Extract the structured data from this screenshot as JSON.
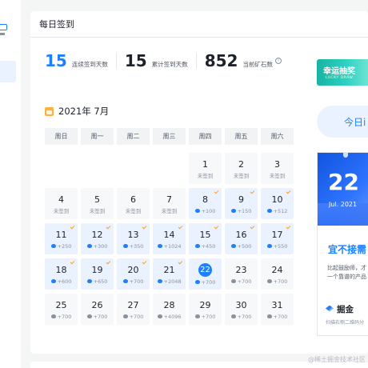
{
  "card": {
    "title": "每日签到"
  },
  "stats": [
    {
      "value": "15",
      "label": "连续签到天数"
    },
    {
      "value": "15",
      "label": "累计签到天数"
    },
    {
      "value": "852",
      "label": "当前矿石数"
    }
  ],
  "info_icon_glyph": "i",
  "calendar": {
    "month_title": "2021年 7月",
    "weekdays": [
      "周日",
      "周一",
      "周二",
      "周三",
      "周四",
      "周五",
      "周六"
    ],
    "leading_blanks": 4,
    "days": [
      {
        "day": "1",
        "sub": "未签到",
        "state": "unsigned"
      },
      {
        "day": "2",
        "sub": "未签到",
        "state": "unsigned"
      },
      {
        "day": "3",
        "sub": "未签到",
        "state": "unsigned"
      },
      {
        "day": "4",
        "sub": "未签到",
        "state": "unsigned"
      },
      {
        "day": "5",
        "sub": "未签到",
        "state": "unsigned"
      },
      {
        "day": "6",
        "sub": "未签到",
        "state": "unsigned"
      },
      {
        "day": "7",
        "sub": "未签到",
        "state": "unsigned"
      },
      {
        "day": "8",
        "sub": "+100",
        "state": "signed"
      },
      {
        "day": "9",
        "sub": "+150",
        "state": "signed"
      },
      {
        "day": "10",
        "sub": "+512",
        "state": "signed"
      },
      {
        "day": "11",
        "sub": "+250",
        "state": "signed"
      },
      {
        "day": "12",
        "sub": "+300",
        "state": "signed"
      },
      {
        "day": "13",
        "sub": "+350",
        "state": "signed"
      },
      {
        "day": "14",
        "sub": "+1024",
        "state": "signed"
      },
      {
        "day": "15",
        "sub": "+450",
        "state": "signed"
      },
      {
        "day": "16",
        "sub": "+500",
        "state": "signed"
      },
      {
        "day": "17",
        "sub": "+550",
        "state": "signed"
      },
      {
        "day": "18",
        "sub": "+600",
        "state": "signed"
      },
      {
        "day": "19",
        "sub": "+650",
        "state": "signed"
      },
      {
        "day": "20",
        "sub": "+700",
        "state": "signed"
      },
      {
        "day": "21",
        "sub": "+2048",
        "state": "signed"
      },
      {
        "day": "22",
        "sub": "+700",
        "state": "today"
      },
      {
        "day": "23",
        "sub": "+700",
        "state": "future"
      },
      {
        "day": "24",
        "sub": "+700",
        "state": "future"
      },
      {
        "day": "25",
        "sub": "+700",
        "state": "future"
      },
      {
        "day": "26",
        "sub": "+700",
        "state": "future"
      },
      {
        "day": "27",
        "sub": "+700",
        "state": "future"
      },
      {
        "day": "28",
        "sub": "+4096",
        "state": "future"
      },
      {
        "day": "29",
        "sub": "+700",
        "state": "future"
      },
      {
        "day": "30",
        "sub": "+700",
        "state": "future"
      },
      {
        "day": "31",
        "sub": "+700",
        "state": "future"
      }
    ]
  },
  "lottery": {
    "title": "幸运抽奖",
    "subtitle": "LUCKY DRAW"
  },
  "today_button": {
    "label": "今日i"
  },
  "promo": {
    "day": "22",
    "month": "Jul. 2021",
    "headline": "宜不接需",
    "line1": "比起鼓励师，才",
    "line2": "一个靠谱的产品",
    "brand": "掘金",
    "scan_text": "扫描右侧二维码分"
  },
  "watermark": "@稀土掘金技术社区",
  "colors": {
    "accent": "#1e80ff",
    "check": "#ff9d24",
    "signed_bg": "#eaf2ff",
    "lottery": "#18b3a3"
  }
}
